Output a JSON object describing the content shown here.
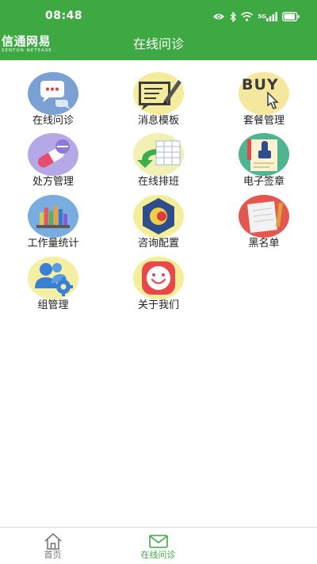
{
  "status": {
    "time": "08:48",
    "signal_label": "5G"
  },
  "header": {
    "logo_cn": "信通网易",
    "logo_en": "SENTON NETEASE",
    "title": "在线问诊"
  },
  "menu": [
    {
      "label": "在线问诊",
      "icon": "chat-bubble-icon"
    },
    {
      "label": "消息模板",
      "icon": "note-pen-icon"
    },
    {
      "label": "套餐管理",
      "icon": "buy-click-icon"
    },
    {
      "label": "处方管理",
      "icon": "pill-capsule-icon"
    },
    {
      "label": "在线排班",
      "icon": "schedule-arrow-icon"
    },
    {
      "label": "电子签章",
      "icon": "document-stamp-icon"
    },
    {
      "label": "工作量统计",
      "icon": "bookshelf-icon"
    },
    {
      "label": "咨询配置",
      "icon": "hexagon-config-icon"
    },
    {
      "label": "黑名单",
      "icon": "notebook-icon"
    },
    {
      "label": "组管理",
      "icon": "group-gear-icon"
    },
    {
      "label": "关于我们",
      "icon": "smiley-icon"
    }
  ],
  "tabbar": {
    "tabs": [
      {
        "label": "首页",
        "icon": "home-icon"
      },
      {
        "label": "在线问诊",
        "icon": "mail-icon"
      }
    ]
  },
  "colors": {
    "brand_green": "#3ea943",
    "tab_inactive": "#777777"
  }
}
